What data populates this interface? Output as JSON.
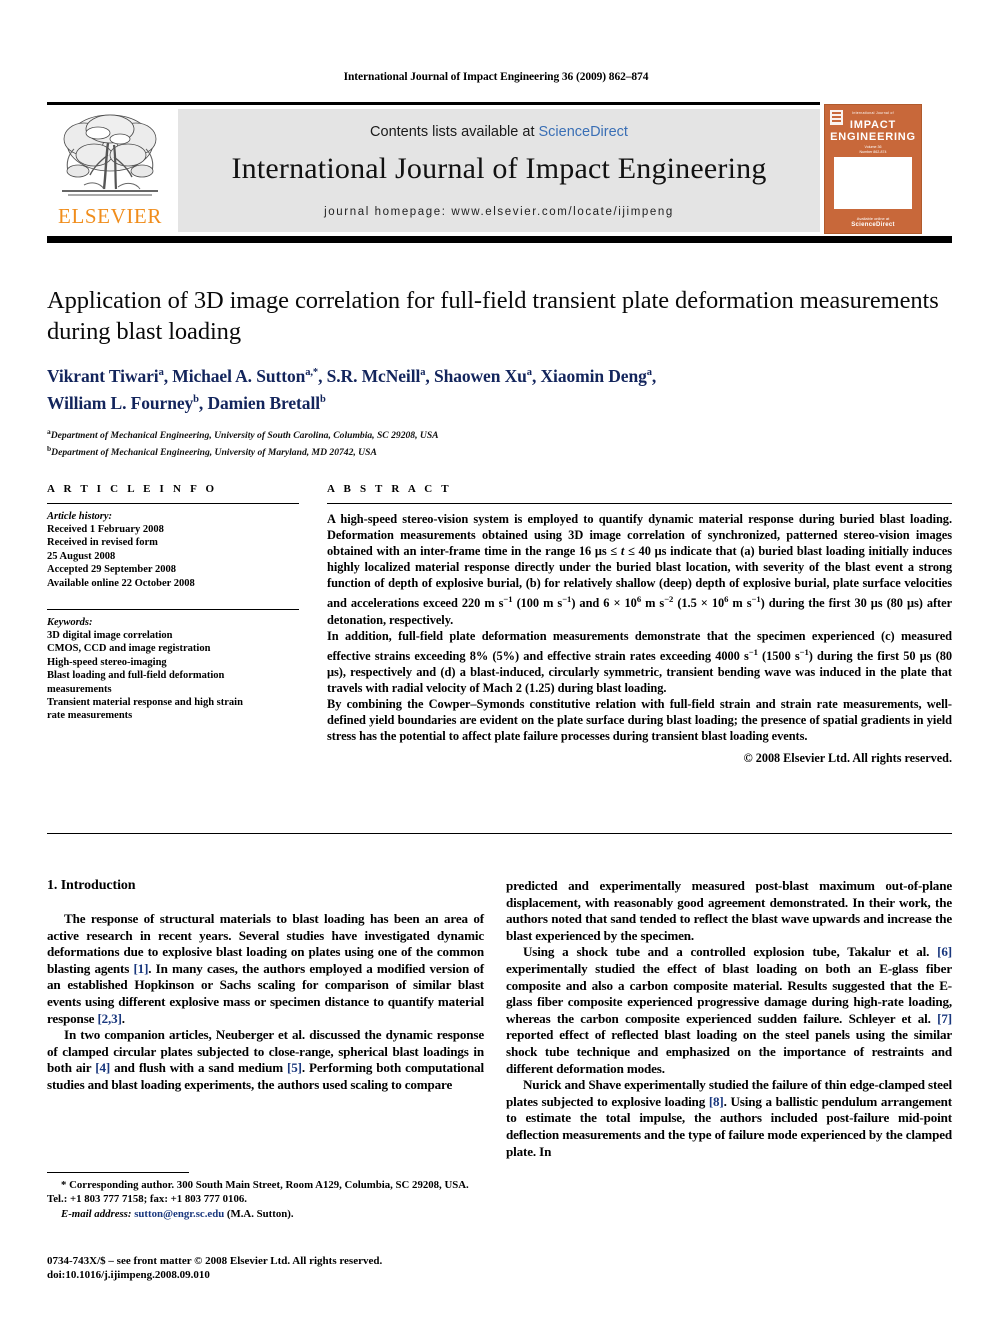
{
  "running_head": "International Journal of Impact Engineering 36 (2009) 862–874",
  "masthead": {
    "contents_prefix": "Contents lists available at ",
    "sciencedirect": "ScienceDirect",
    "journal_title": "International Journal of Impact Engineering",
    "homepage": "journal homepage: www.elsevier.com/locate/ijimpeng",
    "publisher_wordmark": "ELSEVIER",
    "accent_orange": "#F08D1C",
    "link_blue": "#3a6fb5",
    "band_gray": "#e4e4e4"
  },
  "cover": {
    "small_top": "International Journal of",
    "name_line1": "IMPACT",
    "name_line2": "ENGINEERING",
    "volume_line1": "Volume 36",
    "volume_line2": "Number 862-874",
    "bottom_small": "Available online at",
    "bottom_brand": "ScienceDirect",
    "background": "#C8683A"
  },
  "article": {
    "title": "Application of 3D image correlation for full-field transient plate deformation measurements during blast loading",
    "authors_line1_parts": [
      {
        "name": "Vikrant Tiwari",
        "sup": "a"
      },
      {
        "name": "Michael A. Sutton",
        "sup": "a,*"
      },
      {
        "name": "S.R. McNeill",
        "sup": "a"
      },
      {
        "name": "Shaowen Xu",
        "sup": "a"
      },
      {
        "name": "Xiaomin Deng",
        "sup": "a"
      }
    ],
    "authors_line2_parts": [
      {
        "name": "William L. Fourney",
        "sup": "b"
      },
      {
        "name": "Damien Bretall",
        "sup": "b"
      }
    ],
    "authors_line1": "Vikrant Tiwari a, Michael A. Sutton a,*, S.R. McNeill a, Shaowen Xu a, Xiaomin Deng a,",
    "authors_line2": "William L. Fourney b, Damien Bretall b",
    "affiliation_a": "Department of Mechanical Engineering, University of South Carolina, Columbia, SC 29208, USA",
    "affiliation_b": "Department of Mechanical Engineering, University of Maryland, MD 20742, USA",
    "author_color": "#13255c"
  },
  "article_info": {
    "heading": "A R T I C L E  I N F O",
    "history_label": "Article history:",
    "history": [
      "Received 1 February 2008",
      "Received in revised form",
      "25 August 2008",
      "Accepted 29 September 2008",
      "Available online 22 October 2008"
    ],
    "keywords_label": "Keywords:",
    "keywords": [
      "3D digital image correlation",
      "CMOS, CCD and image registration",
      "High-speed stereo-imaging",
      "Blast loading and full-field deformation",
      "measurements",
      "Transient material response and high strain",
      "rate measurements"
    ]
  },
  "abstract": {
    "heading": "A B S T R A C T",
    "paragraph1_a": "A high-speed stereo-vision system is employed to quantify dynamic material response during buried blast loading. Deformation measurements obtained using 3D image correlation of synchronized, patterned stereo-vision images obtained with an inter-frame time in the range 16 μs ≤ ",
    "paragraph1_t": "t",
    "paragraph1_b": " ≤ 40 μs indicate that (a) buried blast loading initially induces highly localized material response directly under the buried blast location, with severity of the blast event a strong function of depth of explosive burial, (b) for relatively shallow (deep) depth of explosive burial, plate surface velocities and accelerations exceed 220 m s",
    "p1_sup1": "−1",
    "p1_mid1": " (100 m s",
    "p1_sup2": "−1",
    "p1_mid2": ") and 6 × 10",
    "p1_sup3": "6",
    "p1_mid3": " m s",
    "p1_sup4": "−2",
    "p1_mid4": " (1.5 × 10",
    "p1_sup5": "6",
    "p1_mid5": " m s",
    "p1_sup6": "−1",
    "p1_end": ") during the first 30 μs (80 μs) after detonation, respectively.",
    "paragraph2_a": "In addition, full-field plate deformation measurements demonstrate that the specimen experienced (c) measured effective strains exceeding 8% (5%) and effective strain rates exceeding 4000 s",
    "p2_sup1": "−1",
    "p2_mid1": " (1500 s",
    "p2_sup2": "−1",
    "p2_end": ") during the first 50 μs (80 μs), respectively and (d) a blast-induced, circularly symmetric, transient bending wave was induced in the plate that travels with radial velocity of Mach 2 (1.25) during blast loading.",
    "paragraph3": "By combining the Cowper–Symonds constitutive relation with full-field strain and strain rate measurements, well-defined yield boundaries are evident on the plate surface during blast loading; the presence of spatial gradients in yield stress has the potential to affect plate failure processes during transient blast loading events.",
    "copyright": "© 2008 Elsevier Ltd. All rights reserved."
  },
  "body": {
    "section_heading": "1. Introduction",
    "left_paragraphs": [
      {
        "parts": [
          {
            "t": "The response of structural materials to blast loading has been an area of active research in recent years. Several studies have investigated dynamic deformations due to explosive blast loading on plates using one of the common blasting agents "
          },
          {
            "t": "[1]",
            "cite": true
          },
          {
            "t": ". In many cases, the authors employed a modified version of an established Hopkinson or Sachs scaling for comparison of similar blast events using different explosive mass or specimen distance to quantify material response "
          },
          {
            "t": "[2,3]",
            "cite": true
          },
          {
            "t": "."
          }
        ]
      },
      {
        "parts": [
          {
            "t": "In two companion articles, Neuberger et al. discussed the dynamic response of clamped circular plates subjected to close-range, spherical blast loadings in both air "
          },
          {
            "t": "[4]",
            "cite": true
          },
          {
            "t": " and flush with a sand medium "
          },
          {
            "t": "[5]",
            "cite": true
          },
          {
            "t": ". Performing both computational studies and blast loading experiments, the authors used scaling to compare"
          }
        ]
      }
    ],
    "right_paragraphs": [
      {
        "parts": [
          {
            "t": "predicted and experimentally measured post-blast maximum out-of-plane displacement, with reasonably good agreement demonstrated. In their work, the authors noted that sand tended to reflect the blast wave upwards and increase the blast experienced by the specimen."
          }
        ],
        "no_indent": true
      },
      {
        "parts": [
          {
            "t": "Using a shock tube and a controlled explosion tube, Takalur et al. "
          },
          {
            "t": "[6]",
            "cite": true
          },
          {
            "t": " experimentally studied the effect of blast loading on both an E-glass fiber composite and also a carbon composite material. Results suggested that the E-glass fiber composite experienced progressive damage during high-rate loading, whereas the carbon composite experienced sudden failure. Schleyer et al. "
          },
          {
            "t": "[7]",
            "cite": true
          },
          {
            "t": " reported effect of reflected blast loading on the steel panels using the similar shock tube technique and emphasized on the importance of restraints and different deformation modes."
          }
        ]
      },
      {
        "parts": [
          {
            "t": "Nurick and Shave experimentally studied the failure of thin edge-clamped steel plates subjected to explosive loading "
          },
          {
            "t": "[8]",
            "cite": true
          },
          {
            "t": ". Using a ballistic pendulum arrangement to estimate the total impulse, the authors included post-failure mid-point deflection measurements and the type of failure mode experienced by the clamped plate. In"
          }
        ]
      }
    ],
    "cite_color": "#19377d"
  },
  "footnotes": {
    "corresponding_marker": "*",
    "corresponding": " Corresponding author. 300 South Main Street, Room A129, Columbia, SC 29208, USA. Tel.: +1 803 777 7158; fax: +1 803 777 0106.",
    "email_label": "E-mail address:",
    "email": "sutton@engr.sc.edu",
    "email_owner": " (M.A. Sutton).",
    "imprint_line1": "0734-743X/$ – see front matter © 2008 Elsevier Ltd. All rights reserved.",
    "imprint_line2": "doi:10.1016/j.ijimpeng.2008.09.010"
  }
}
